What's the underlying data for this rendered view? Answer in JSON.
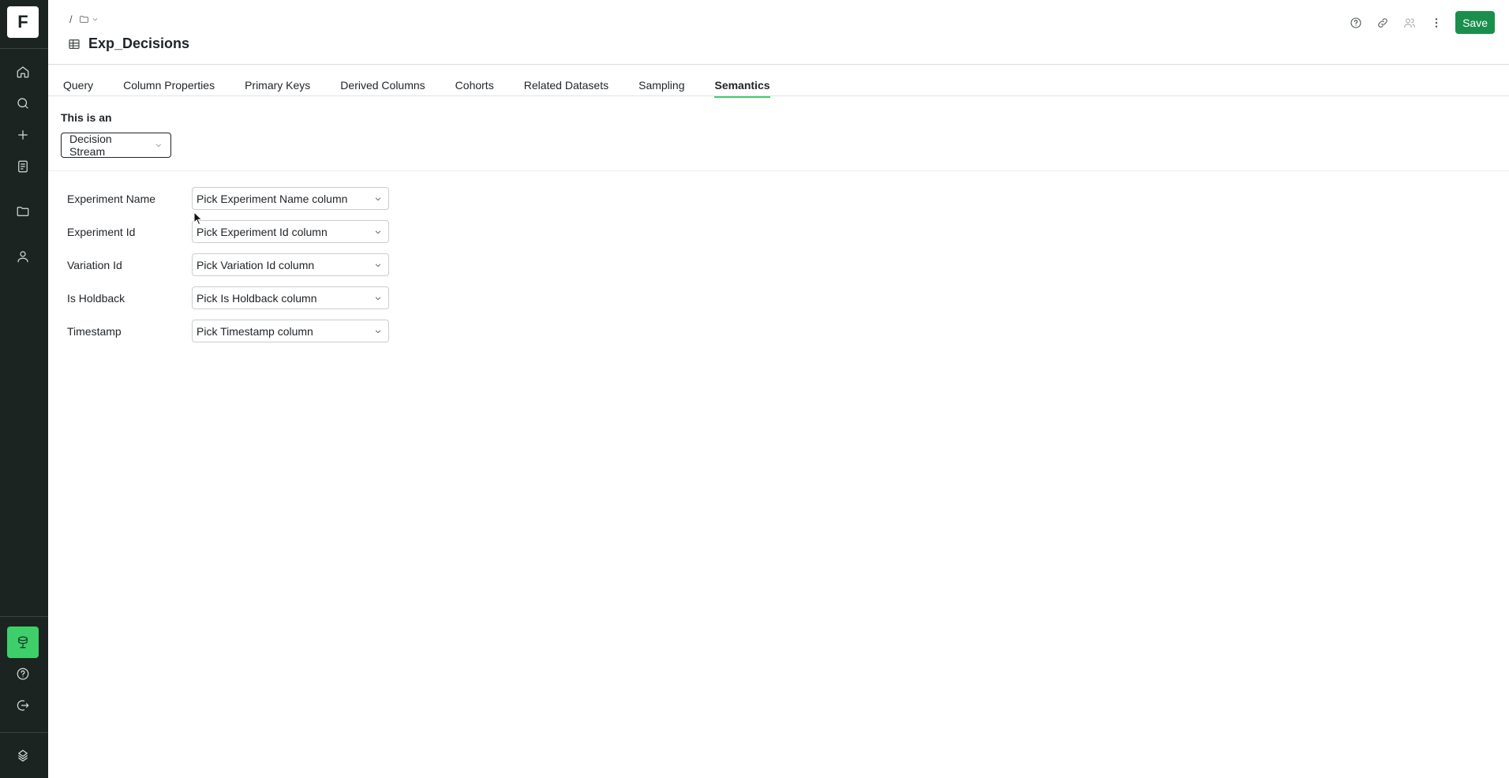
{
  "app": {
    "logo_letter": "F"
  },
  "sidebar": {
    "top_items": [
      {
        "icon": "home-icon"
      },
      {
        "icon": "search-icon"
      },
      {
        "icon": "plus-icon"
      },
      {
        "icon": "notebook-icon"
      },
      {
        "icon": "folder-icon"
      },
      {
        "icon": "user-icon"
      }
    ],
    "bottom_items": [
      {
        "icon": "dataset-icon",
        "active": true
      },
      {
        "icon": "help-icon"
      },
      {
        "icon": "logout-icon"
      },
      {
        "icon": "brand-icon"
      }
    ],
    "accent_color": "#3ecf6b",
    "bg_color": "#1c2421"
  },
  "header": {
    "breadcrumb_sep": "/",
    "title": "Exp_Decisions",
    "save_label": "Save",
    "save_color": "#1a8f4b"
  },
  "tabs": [
    {
      "label": "Query"
    },
    {
      "label": "Column Properties"
    },
    {
      "label": "Primary Keys"
    },
    {
      "label": "Derived Columns"
    },
    {
      "label": "Cohorts"
    },
    {
      "label": "Related Datasets"
    },
    {
      "label": "Sampling"
    },
    {
      "label": "Semantics",
      "active": true
    }
  ],
  "semantics": {
    "heading": "This is an",
    "entity_type": "Decision Stream",
    "fields": [
      {
        "label": "Experiment Name",
        "placeholder": "Pick Experiment Name column"
      },
      {
        "label": "Experiment Id",
        "placeholder": "Pick Experiment Id column"
      },
      {
        "label": "Variation Id",
        "placeholder": "Pick Variation Id column"
      },
      {
        "label": "Is Holdback",
        "placeholder": "Pick Is Holdback column"
      },
      {
        "label": "Timestamp",
        "placeholder": "Pick Timestamp column"
      }
    ]
  }
}
